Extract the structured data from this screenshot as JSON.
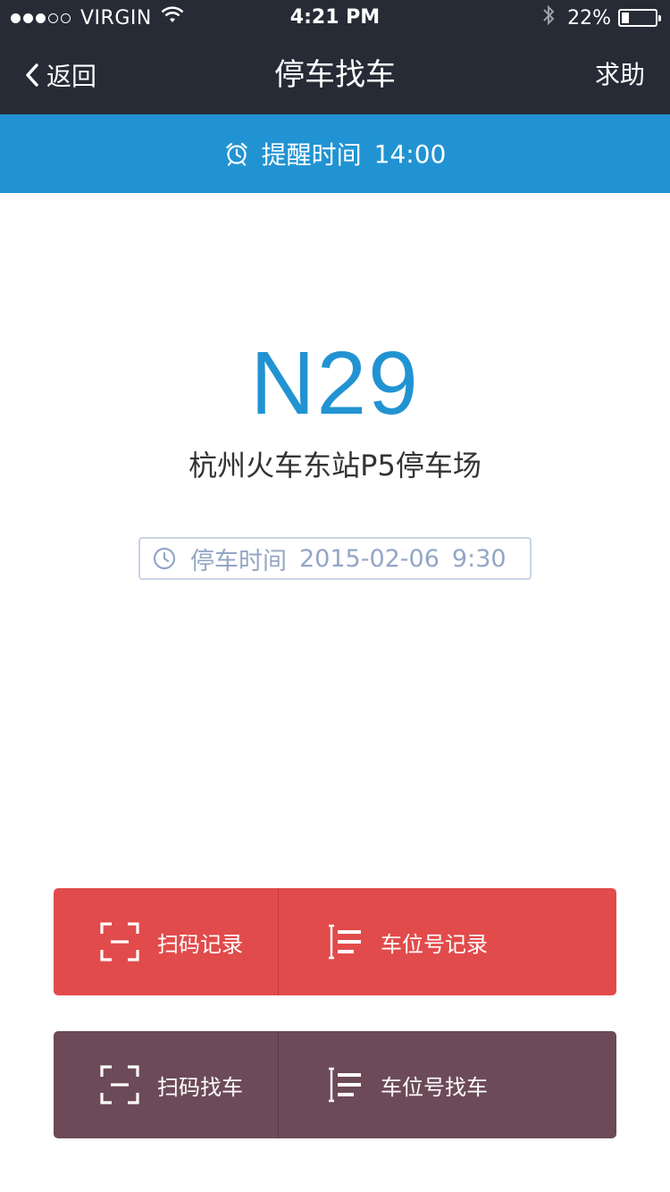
{
  "status_bar": {
    "carrier": "VIRGIN",
    "time": "4:21 PM",
    "battery": "22%",
    "battery_level": 0.22
  },
  "nav": {
    "back_label": "返回",
    "title": "停车找车",
    "help_label": "求助"
  },
  "reminder": {
    "label": "提醒时间",
    "time": "14:00"
  },
  "parking": {
    "spot": "N29",
    "lot": "杭州火车东站P5停车场",
    "time_label": "停车时间",
    "date": "2015-02-06",
    "time": "9:30"
  },
  "actions": {
    "scan_record": "扫码记录",
    "spot_record": "车位号记录",
    "scan_find": "扫码找车",
    "spot_find": "车位号找车"
  },
  "colors": {
    "nav_bg": "#262b36",
    "accent_blue": "#2293d2",
    "record_red": "#e14b4b",
    "find_purple": "#6c4a58"
  }
}
